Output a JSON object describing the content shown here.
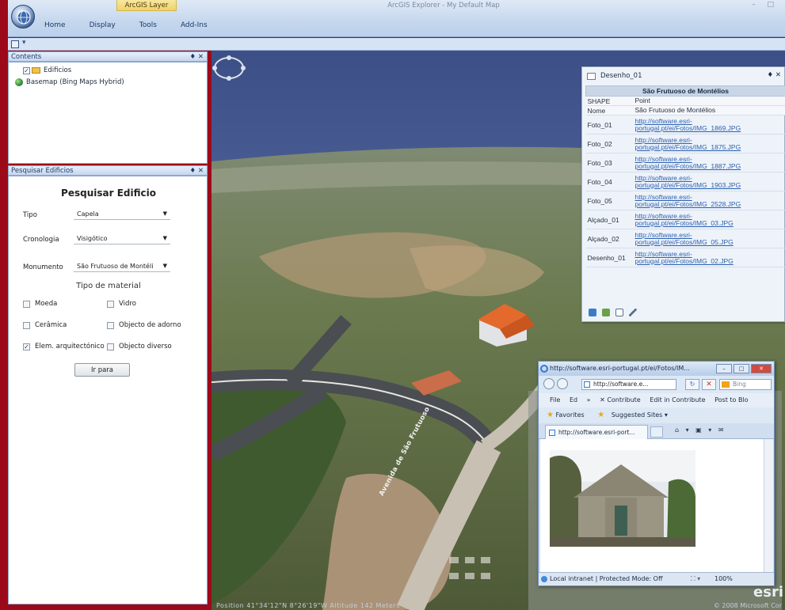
{
  "window": {
    "title": "ArcGIS Explorer - My Default Map",
    "controls": "– □"
  },
  "ribbon": {
    "contextual_tab": "ArcGIS Layer",
    "tabs": [
      "Home",
      "Display",
      "Tools",
      "Add-Ins"
    ]
  },
  "qat": {
    "dropdown": "▾"
  },
  "contents_panel": {
    "title": "Contents",
    "pin": "♦ ✕",
    "items": [
      {
        "label": "Edificios",
        "checked": true,
        "icon": "folder-icon"
      },
      {
        "label": "Basemap (Bing Maps Hybrid)",
        "checked": false,
        "icon": "globe-icon"
      }
    ]
  },
  "search_panel": {
    "title": "Pesquisar Edificios",
    "pin": "♦ ✕",
    "heading": "Pesquisar Edificio",
    "fields": [
      {
        "label": "Tipo",
        "value": "Capela"
      },
      {
        "label": "Cronologia",
        "value": "Visigótico"
      },
      {
        "label": "Monumento",
        "value": "São Frutuoso de Montéli"
      }
    ],
    "material_heading": "Tipo de material",
    "materials": [
      {
        "label": "Moeda",
        "checked": false
      },
      {
        "label": "Vidro",
        "checked": false
      },
      {
        "label": "Cerâmica",
        "checked": false
      },
      {
        "label": "Objecto de adorno",
        "checked": false
      },
      {
        "label": "Elem. arquitectónico",
        "checked": true
      },
      {
        "label": "Objecto diverso",
        "checked": false
      }
    ],
    "button": "Ir para"
  },
  "map": {
    "street_label": "Avenida de São Frutuoso",
    "status": "Position 41°34'12\"N 8°26'19\"W  Altitude 142 Meters",
    "copyright": "© 2008 Microsoft Cor",
    "logo": "esri"
  },
  "popup": {
    "title": "Desenho_01",
    "controls": "♦ ✕",
    "header": "São Frutuoso de Montélios",
    "rows": [
      {
        "key": "SHAPE",
        "value": "Point",
        "link": false
      },
      {
        "key": "Nome",
        "value": "São Frutuoso de Montélios",
        "link": false
      },
      {
        "key": "Foto_01",
        "value": "http://software.esri-portugal.pt/ei/Fotos/IMG_1869.JPG",
        "link": true
      },
      {
        "key": "Foto_02",
        "value": "http://software.esri-portugal.pt/ei/Fotos/IMG_1875.JPG",
        "link": true
      },
      {
        "key": "Foto_03",
        "value": "http://software.esri-portugal.pt/ei/Fotos/IMG_1887.JPG",
        "link": true
      },
      {
        "key": "Foto_04",
        "value": "http://software.esri-portugal.pt/ei/Fotos/IMG_1903.JPG",
        "link": true
      },
      {
        "key": "Foto_05",
        "value": "http://software.esri-portugal.pt/ei/Fotos/IMG_2528.JPG",
        "link": true
      },
      {
        "key": "Alçado_01",
        "value": "http://software.esri-portugal.pt/ei/Fotos/IMG_03.JPG",
        "link": true
      },
      {
        "key": "Alçado_02",
        "value": "http://software.esri-portugal.pt/ei/Fotos/IMG_05.JPG",
        "link": true
      },
      {
        "key": "Desenho_01",
        "value": "http://software.esri-portugal.pt/ei/Fotos/IMG_02.JPG",
        "link": true
      }
    ]
  },
  "browser": {
    "title": "http://software.esri-portugal.pt/ei/Fotos/IM...",
    "address": "http://software.e...",
    "search_placeholder": "Bing",
    "menu": [
      "File",
      "Ed",
      "»",
      "✕ Contribute",
      "Edit in Contribute",
      "Post to Blo"
    ],
    "favorites": "Favorites",
    "suggested": "Suggested Sites ▾",
    "tab": "http://software.esri-port...",
    "status": "Local intranet | Protected Mode: Off",
    "zoom": "100%"
  }
}
